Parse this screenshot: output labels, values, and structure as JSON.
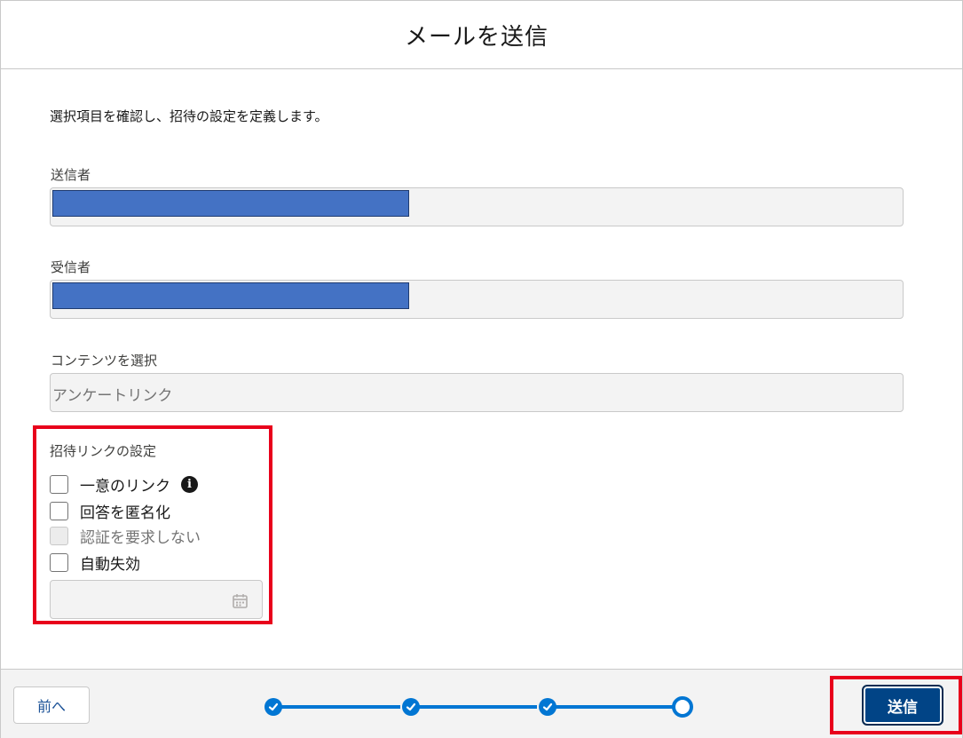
{
  "modal": {
    "title": "メールを送信"
  },
  "form": {
    "instruction": "選択項目を確認し、招待の設定を定義します。",
    "sender_label": "送信者",
    "recipient_label": "受信者",
    "content_label": "コンテンツを選択",
    "content_value": "アンケートリンク"
  },
  "invite_settings": {
    "title": "招待リンクの設定",
    "options": [
      {
        "label": "一意のリンク",
        "checked": false,
        "disabled": false
      },
      {
        "label": "回答を匿名化",
        "checked": false,
        "disabled": false
      },
      {
        "label": "認証を要求しない",
        "checked": false,
        "disabled": true
      },
      {
        "label": "自動失効",
        "checked": false,
        "disabled": false
      }
    ],
    "info_icon": "info-icon",
    "date_icon": "calendar-icon"
  },
  "footer": {
    "prev_label": "前へ",
    "send_label": "送信",
    "steps_total": 4,
    "steps_completed": 3
  },
  "colors": {
    "brand": "#0176d3",
    "send_button": "#014486",
    "highlight": "#e8001b",
    "redaction": "#4472c4"
  }
}
